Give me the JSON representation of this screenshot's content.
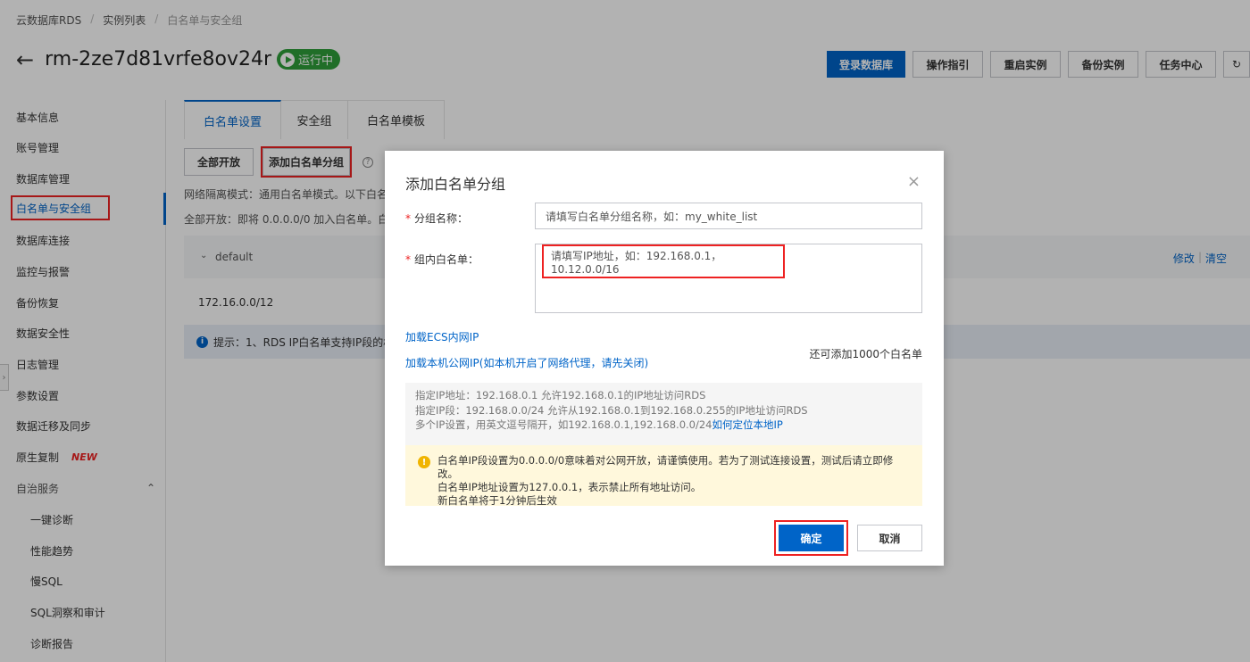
{
  "breadcrumb": [
    "云数据库RDS",
    "实例列表",
    "白名单与安全组"
  ],
  "header": {
    "title": "rm-2ze7d81vrfe8ov24r",
    "status": "运行中",
    "actions": [
      "登录数据库",
      "操作指引",
      "重启实例",
      "备份实例",
      "任务中心"
    ]
  },
  "sidebar": {
    "items": [
      "基本信息",
      "账号管理",
      "数据库管理",
      "白名单与安全组",
      "数据库连接",
      "监控与报警",
      "备份恢复",
      "数据安全性",
      "日志管理",
      "参数设置",
      "数据迁移及同步",
      "原生复制"
    ],
    "new_badge": "NEW",
    "group_label": "自治服务",
    "sub_items": [
      "一键诊断",
      "性能趋势",
      "慢SQL",
      "SQL洞察和审计",
      "诊断报告"
    ]
  },
  "main": {
    "tabs": [
      "白名单设置",
      "安全组",
      "白名单模板"
    ],
    "open_all": "全部开放",
    "add_group": "添加白名单分组",
    "note1": "网络隔离模式：通用白名单模式。以下白名单",
    "note2": "全部开放：即将 0.0.0.0/0 加入白名单。白名",
    "group_name": "default",
    "edit": "修改",
    "clear": "清空",
    "ip_value": "172.16.0.0/12",
    "tip": "提示：1、RDS IP白名单支持IP段的格"
  },
  "modal": {
    "title": "添加白名单分组",
    "name_label": "分组名称：",
    "name_placeholder": "请填写白名单分组名称，如：my_white_list",
    "ip_label": "组内白名单：",
    "ip_placeholder": "请填写IP地址，如：192.168.0.1，10.12.0.0/16",
    "link_ecs": "加载ECS内网IP",
    "link_public": "加载本机公网IP(如本机开启了网络代理，请先关闭)",
    "remain": "还可添加1000个白名单",
    "help_lines": [
      "指定IP地址：192.168.0.1 允许192.168.0.1的IP地址访问RDS",
      "指定IP段：192.168.0.0/24 允许从192.168.0.1到192.168.0.255的IP地址访问RDS",
      "多个IP设置，用英文逗号隔开，如192.168.0.1,192.168.0.0/24"
    ],
    "help_link": "如何定位本地IP",
    "warn_lines": [
      "白名单IP段设置为0.0.0.0/0意味着对公网开放，请谨慎使用。若为了测试连接设置，测试后请立即修改。",
      "白名单IP地址设置为127.0.0.1，表示禁止所有地址访问。",
      "新白名单将于1分钟后生效"
    ],
    "ok": "确定",
    "cancel": "取消"
  }
}
